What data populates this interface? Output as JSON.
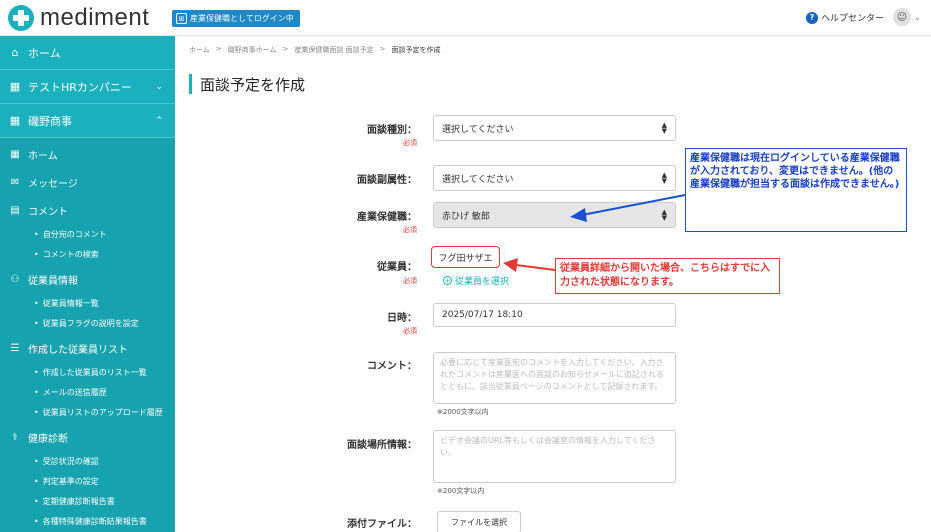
{
  "header": {
    "logo_text": "mediment",
    "login_badge": "産業保健職としてログイン中",
    "badge_icon_glyph": "⊞",
    "help_label": "ヘルプセンター",
    "help_glyph": "?",
    "user_glyph": "ⓢ"
  },
  "sidebar": {
    "home": "ホーム",
    "company": "テストHRカンパニー",
    "client": "磯野商事",
    "items": {
      "home": "ホーム",
      "message": "メッセージ",
      "comment": "コメント",
      "comment_mine": "自分宛のコメント",
      "comment_search": "コメントの検索",
      "employee_info": "従業員情報",
      "employee_list": "従業員情報一覧",
      "employee_flag": "従業員フラグの説明を設定",
      "created_list": "作成した従業員リスト",
      "created_list_list": "作成した従業員のリスト一覧",
      "mail_history": "メールの送信履歴",
      "upload_history": "従業員リストのアップロード履歴",
      "health_check": "健康診断",
      "status": "受診状況の確認",
      "criteria": "判定基準の設定",
      "report": "定期健康診断報告書",
      "special_report": "各種特殊健康診断結果報告書"
    }
  },
  "breadcrumb": [
    "ホーム",
    "磯野商事ホーム",
    "産業保健職面談 面談予定",
    "面談予定を作成"
  ],
  "breadcrumb_sep": ">",
  "page_title": "面談予定を作成",
  "form": {
    "required": "必須",
    "type_label": "面談種別：",
    "type_value": "選択してください",
    "subattr_label": "面談副属性：",
    "subattr_value": "選択してください",
    "staff_label": "産業保健職：",
    "staff_value": "赤ひげ 敏郎",
    "employee_label": "従業員：",
    "employee_value": "フグ田サザエ",
    "employee_link": "従業員を選択",
    "datetime_label": "日時：",
    "datetime_value": "2025/07/17 18:10",
    "comment_label": "コメント：",
    "comment_placeholder": "必要に応じて産業医宛のコメントを入力してください。入力されたコメントは産業医への面談のお知らせメールに追記されるとともに、該当従業員ページのコメントとして記録されます。",
    "comment_note": "※2000文字以内",
    "place_label": "面談場所情報：",
    "place_placeholder": "ビデオ会議のURL等もしくは会議室の情報を入力してください。",
    "place_note": "※200文字以内",
    "file_label": "添付ファイル：",
    "file_button": "ファイルを選択"
  },
  "callouts": {
    "blue": "産業保健職は現在ログインしている産業保健職が入力されており、変更はできません。(他の産業保健職が担当する面談は作成できません。)",
    "red": "従業員詳細から開いた場合、こちらはすでに入力された状態になります。"
  },
  "colors": {
    "accent": "#1ab0bd",
    "blue_callout": "#1a4fd6",
    "red_callout": "#e53935"
  }
}
